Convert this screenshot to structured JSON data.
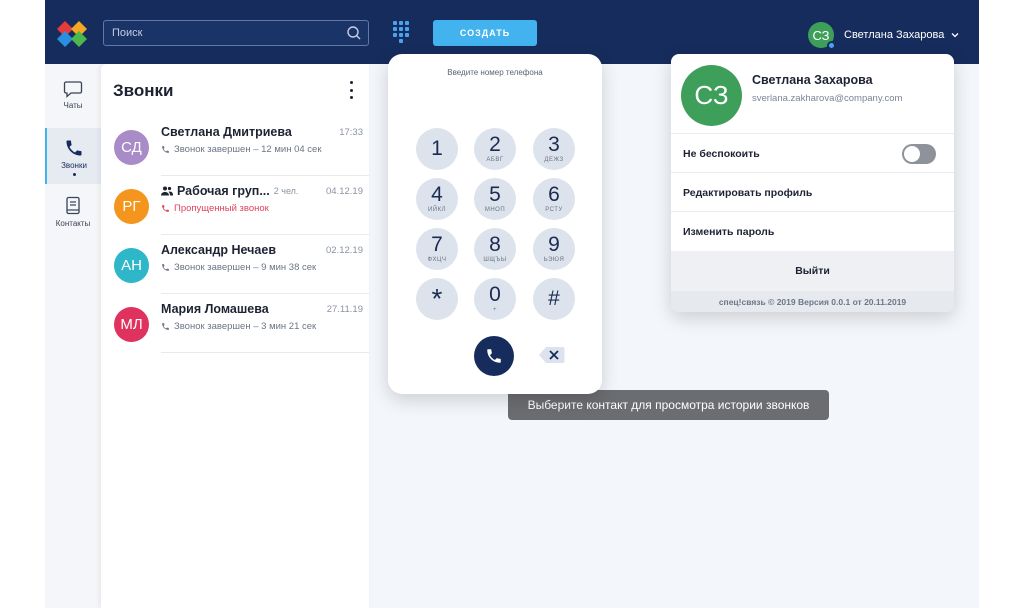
{
  "header": {
    "search_placeholder": "Поиск",
    "create_label": "СОЗДАТЬ",
    "user": {
      "initials": "СЗ",
      "name": "Светлана Захарова"
    }
  },
  "nav": {
    "items": [
      {
        "label": "Чаты",
        "icon": "chat-bubble-icon",
        "active": false
      },
      {
        "label": "Звонки",
        "icon": "phone-icon",
        "active": true
      },
      {
        "label": "Контакты",
        "icon": "contacts-book-icon",
        "active": false
      }
    ]
  },
  "calls": {
    "title": "Звонки",
    "items": [
      {
        "initials": "СД",
        "color": "#a98bc7",
        "name": "Светлана Дмитриева",
        "members": "",
        "date": "17:33",
        "status": "Звонок завершен – 12 мин 04 сек",
        "missed": false,
        "group": false
      },
      {
        "initials": "РГ",
        "color": "#f4951d",
        "name": "Рабочая груп...",
        "members": "2 чел.",
        "date": "04.12.19",
        "status": "Пропущенный звонок",
        "missed": true,
        "group": true
      },
      {
        "initials": "АН",
        "color": "#2db7c9",
        "name": "Александр Нечаев",
        "members": "",
        "date": "02.12.19",
        "status": "Звонок завершен – 9 мин 38 сек",
        "missed": false,
        "group": false
      },
      {
        "initials": "МЛ",
        "color": "#e0325f",
        "name": "Мария Ломашева",
        "members": "",
        "date": "27.11.19",
        "status": "Звонок завершен – 3 мин 21 сек",
        "missed": false,
        "group": false
      }
    ]
  },
  "dialpad": {
    "label": "Введите номер телефона",
    "keys": [
      {
        "digit": "1",
        "letters": ""
      },
      {
        "digit": "2",
        "letters": "АБВГ"
      },
      {
        "digit": "3",
        "letters": "ДЕЖЗ"
      },
      {
        "digit": "4",
        "letters": "ИЙКЛ"
      },
      {
        "digit": "5",
        "letters": "МНОП"
      },
      {
        "digit": "6",
        "letters": "РСТУ"
      },
      {
        "digit": "7",
        "letters": "ФХЦЧ"
      },
      {
        "digit": "8",
        "letters": "ШЩЪЫ"
      },
      {
        "digit": "9",
        "letters": "ЬЭЮЯ"
      },
      {
        "digit": "*",
        "letters": ""
      },
      {
        "digit": "0",
        "letters": "+"
      },
      {
        "digit": "#",
        "letters": ""
      }
    ]
  },
  "empty_hint": "Выберите контакт для просмотра истории звонков",
  "profile": {
    "initials": "СЗ",
    "name": "Светлана Захарова",
    "email": "sverlana.zakharova@company.com",
    "dnd_label": "Не беспокоить",
    "dnd_on": false,
    "edit_label": "Редактировать профиль",
    "password_label": "Изменить пароль",
    "logout_label": "Выйти",
    "footer": "спец!связь © 2019 Версия 0.0.1 от 20.11.2019"
  },
  "colors": {
    "header_bg": "#162c5c",
    "accent": "#43b3f0",
    "avatar_green": "#3e9f5b",
    "missed": "#e0425c"
  }
}
